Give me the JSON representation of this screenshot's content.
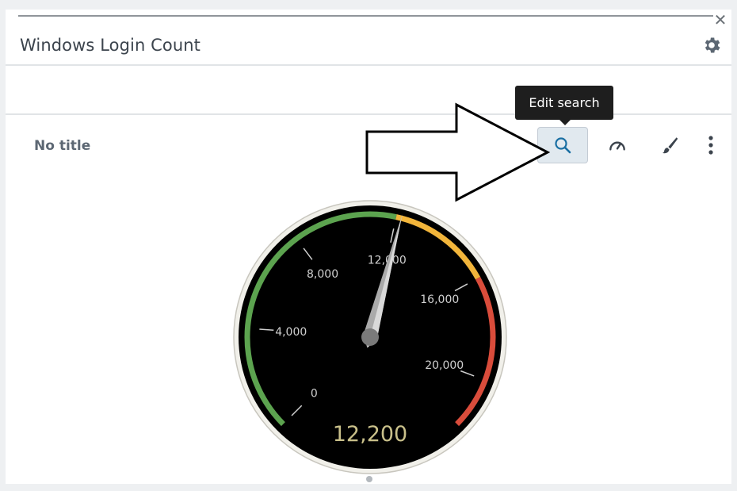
{
  "panel": {
    "title": "Windows Login Count",
    "close_glyph": "✕"
  },
  "visualization": {
    "title": "No title",
    "toolbar": [
      {
        "name": "search-icon",
        "tooltip": "Edit search",
        "active": true
      },
      {
        "name": "gauge-icon"
      },
      {
        "name": "brush-icon"
      },
      {
        "name": "more-vertical-icon"
      }
    ]
  },
  "tooltip": {
    "text": "Edit search"
  },
  "gauge": {
    "value": 12200,
    "value_label": "12,200",
    "min": 0,
    "max": 22000,
    "tick_labels": [
      "0",
      "4,000",
      "8,000",
      "12,000",
      "16,000",
      "20,000"
    ],
    "tick_values": [
      0,
      4000,
      8000,
      12000,
      16000,
      20000
    ],
    "ranges": [
      {
        "from": 0,
        "to": 12000,
        "color": "#5ca34f"
      },
      {
        "from": 12000,
        "to": 16000,
        "color": "#f2b53b"
      },
      {
        "from": 16000,
        "to": 22000,
        "color": "#d94c3b"
      }
    ],
    "value_color": "#c9c08a"
  }
}
